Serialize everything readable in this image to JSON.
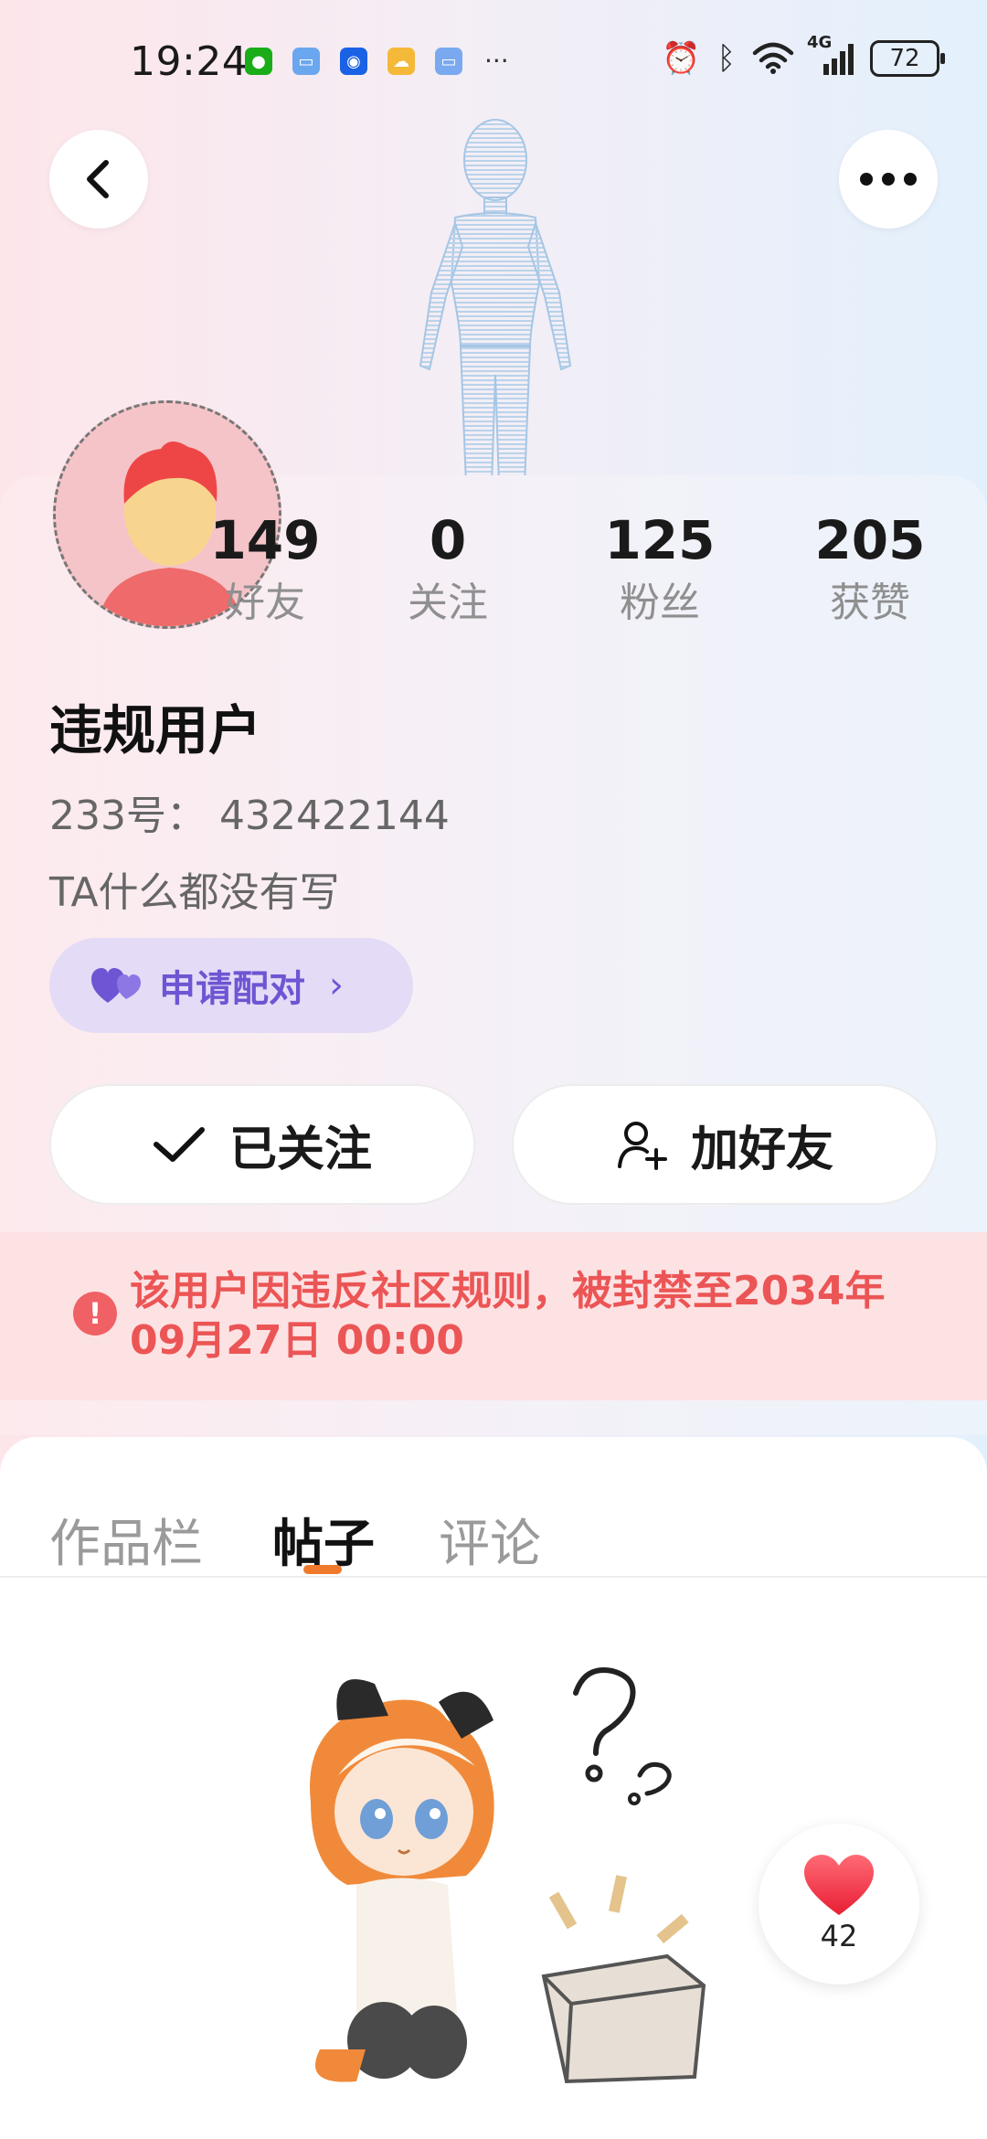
{
  "status_bar": {
    "time": "19:24",
    "more": "···",
    "network": "4G",
    "battery": "72",
    "app_icons": [
      {
        "name": "wechat-icon",
        "color": "#1aad19"
      },
      {
        "name": "app-icon-blue",
        "color": "#6aa7ef"
      },
      {
        "name": "bulb-icon",
        "color": "#1b61e6"
      },
      {
        "name": "weather-icon",
        "color": "#f5b93a"
      },
      {
        "name": "app-icon-blue-2",
        "color": "#7aa9ef"
      }
    ]
  },
  "profile": {
    "username": "违规用户",
    "uid_text": "233号：  432422144",
    "bio": "TA什么都没有写",
    "stats": [
      {
        "value": "149",
        "label": "好友"
      },
      {
        "value": "0",
        "label": "关注"
      },
      {
        "value": "125",
        "label": "粉丝"
      },
      {
        "value": "205",
        "label": "获赞"
      }
    ],
    "match_label": "申请配对",
    "match_chevron": "›",
    "follow_label": "已关注",
    "add_friend_label": "加好友"
  },
  "ban_notice": {
    "icon": "!",
    "text": "该用户因违反社区规则，被封禁至2034年09月27日 00:00"
  },
  "tabs": [
    {
      "label": "作品栏",
      "active": false
    },
    {
      "label": "帖子",
      "active": true
    },
    {
      "label": "评论",
      "active": false
    }
  ],
  "floating_like": {
    "count": "42"
  },
  "colors": {
    "accent_purple": "#6f55d3",
    "ban_red": "#ec5555",
    "tab_indicator": "#f07a2c",
    "heart": "#f43f4f"
  }
}
